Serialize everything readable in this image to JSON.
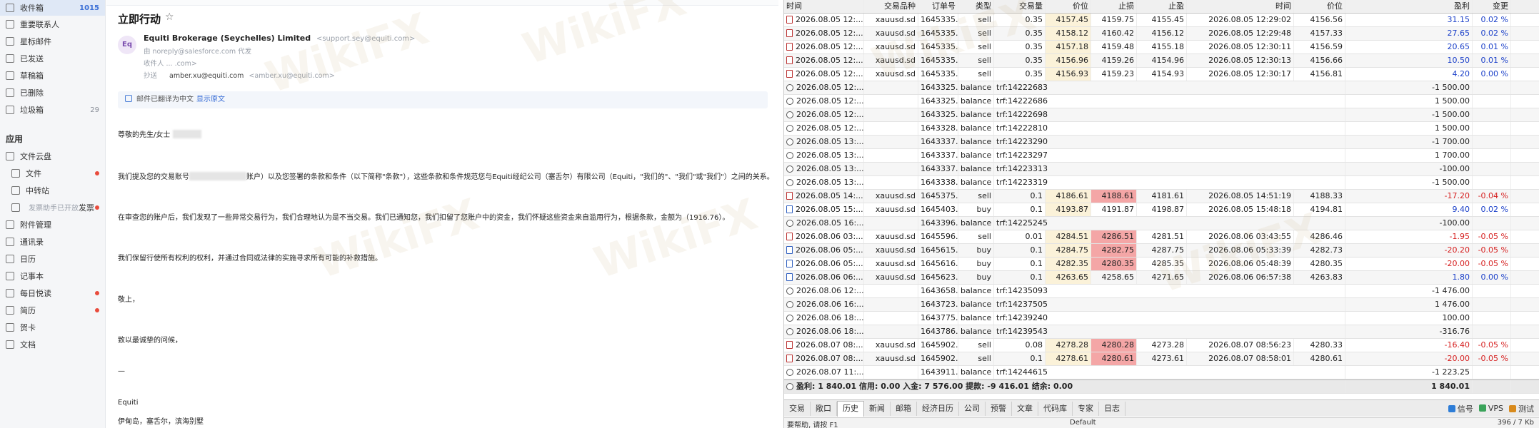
{
  "sidebar": {
    "items": [
      {
        "label": "收件箱",
        "count": "1015",
        "active": true
      },
      {
        "label": "重要联系人"
      },
      {
        "label": "星标邮件"
      },
      {
        "label": "已发送"
      },
      {
        "label": "草稿箱"
      },
      {
        "label": "已删除"
      },
      {
        "label": "垃圾箱",
        "count": "29"
      }
    ],
    "apps_title": "应用",
    "apps": [
      {
        "label": "文件云盘",
        "expand": true
      },
      {
        "label": "文件",
        "dot": true,
        "sub": true
      },
      {
        "label": "中转站",
        "sub": true
      },
      {
        "label": "发票",
        "hint": "发票助手已开放",
        "dot": true,
        "sub": true
      },
      {
        "label": "附件管理"
      },
      {
        "label": "通讯录"
      },
      {
        "label": "日历"
      },
      {
        "label": "记事本"
      },
      {
        "label": "每日悦读",
        "dot": true
      },
      {
        "label": "简历",
        "dot": true
      },
      {
        "label": "贺卡"
      },
      {
        "label": "文档"
      }
    ]
  },
  "mail": {
    "title": "立即行动",
    "avatar": "Eq",
    "sender_name": "Equiti Brokerage (Seychelles) Limited",
    "sender_email": "<support.sey@equiti.com>",
    "from_row": "由 noreply@salesforce.com 代发",
    "to_row": "收件人 ... .com>",
    "cc_label": "抄送",
    "cc_value": "amber.xu@equiti.com",
    "cc_email": "<amber.xu@equiti.com>",
    "translate_text": "邮件已翻译为中文",
    "translate_link": "显示原文",
    "greeting": "尊敬的先生/女士",
    "p1a": "我们提及您的交易账号",
    "p1b": "账户）以及您签署的条款和条件（以下简称\"条款\"），这些条款和条件规范您与Equiti经纪公司（塞舌尔）有限公司（Equiti，\"我们的\"、\"我们\"或\"我们\"）之间的关系。",
    "p2": "在审查您的账户后，我们发现了一些异常交易行为，我们合理地认为是不当交易。我们已通知您，我们扣留了您账户中的资金，我们怀疑这些资金来自滥用行为，根据条款，金额为（1916.76）。",
    "p3": "我们保留行使所有权利的权利，并通过合同或法律的实施寻求所有可能的补救措施。",
    "regards": "敬上，",
    "closing": "致以最诚挚的问候，",
    "dash": "—",
    "company": "Equiti",
    "address": "伊甸岛，塞舌尔，滨海别墅",
    "watermark": "WikiFX"
  },
  "terminal": {
    "headers": [
      "时间",
      "交易品种",
      "订单号",
      "类型",
      "交易量",
      "价位",
      "止损",
      "止盈",
      "时间",
      "价位",
      "盈利",
      "变更"
    ],
    "rows": [
      {
        "kind": "sell",
        "time": "2026.08.05 12:...",
        "sym": "xauusd.sd",
        "order": "1645335...",
        "type": "sell",
        "vol": "0.35",
        "price": "4157.45",
        "sl": "4159.75",
        "tp": "4155.45",
        "ctime": "2026.08.05 12:29:02",
        "cprice": "4156.56",
        "profit": "31.15",
        "change": "0.02 %",
        "pc": "blue",
        "chc": "blue"
      },
      {
        "kind": "sell",
        "time": "2026.08.05 12:...",
        "sym": "xauusd.sd",
        "order": "1645335...",
        "type": "sell",
        "vol": "0.35",
        "price": "4158.12",
        "sl": "4160.42",
        "tp": "4156.12",
        "ctime": "2026.08.05 12:29:48",
        "cprice": "4157.33",
        "profit": "27.65",
        "change": "0.02 %",
        "pc": "blue",
        "chc": "blue"
      },
      {
        "kind": "sell",
        "time": "2026.08.05 12:...",
        "sym": "xauusd.sd",
        "order": "1645335...",
        "type": "sell",
        "vol": "0.35",
        "price": "4157.18",
        "sl": "4159.48",
        "tp": "4155.18",
        "ctime": "2026.08.05 12:30:11",
        "cprice": "4156.59",
        "profit": "20.65",
        "change": "0.01 %",
        "pc": "blue",
        "chc": "blue"
      },
      {
        "kind": "sell",
        "time": "2026.08.05 12:...",
        "sym": "xauusd.sd",
        "order": "1645335...",
        "type": "sell",
        "vol": "0.35",
        "price": "4156.96",
        "sl": "4159.26",
        "tp": "4154.96",
        "ctime": "2026.08.05 12:30:13",
        "cprice": "4156.66",
        "profit": "10.50",
        "change": "0.01 %",
        "pc": "blue",
        "chc": "blue"
      },
      {
        "kind": "sell",
        "time": "2026.08.05 12:...",
        "sym": "xauusd.sd",
        "order": "1645335...",
        "type": "sell",
        "vol": "0.35",
        "price": "4156.93",
        "sl": "4159.23",
        "tp": "4154.93",
        "ctime": "2026.08.05 12:30:17",
        "cprice": "4156.81",
        "profit": "4.20",
        "change": "0.00 %",
        "pc": "blue",
        "chc": "blue"
      },
      {
        "kind": "bal",
        "time": "2026.08.05 12:...",
        "order": "1643325...",
        "type": "balance",
        "comment": "trf:14222683",
        "profit": "-1 500.00"
      },
      {
        "kind": "bal",
        "time": "2026.08.05 12:...",
        "order": "1643325...",
        "type": "balance",
        "comment": "trf:14222686",
        "profit": "1 500.00"
      },
      {
        "kind": "bal",
        "time": "2026.08.05 12:...",
        "order": "1643325...",
        "type": "balance",
        "comment": "trf:14222698",
        "profit": "-1 500.00"
      },
      {
        "kind": "bal",
        "time": "2026.08.05 12:...",
        "order": "1643328...",
        "type": "balance",
        "comment": "trf:14222810",
        "profit": "1 500.00"
      },
      {
        "kind": "bal",
        "time": "2026.08.05 13:...",
        "order": "1643337...",
        "type": "balance",
        "comment": "trf:14223290",
        "profit": "-1 700.00"
      },
      {
        "kind": "bal",
        "time": "2026.08.05 13:...",
        "order": "1643337...",
        "type": "balance",
        "comment": "trf:14223297",
        "profit": "1 700.00"
      },
      {
        "kind": "bal",
        "time": "2026.08.05 13:...",
        "order": "1643337...",
        "type": "balance",
        "comment": "trf:14223313",
        "profit": "-100.00"
      },
      {
        "kind": "bal",
        "time": "2026.08.05 13:...",
        "order": "1643338...",
        "type": "balance",
        "comment": "trf:14223319",
        "profit": "-1 500.00"
      },
      {
        "kind": "sell",
        "time": "2026.08.05 14:...",
        "sym": "xauusd.sd",
        "order": "1645375...",
        "type": "sell",
        "vol": "0.1",
        "price": "4186.61",
        "sl": "4188.61",
        "tp": "4181.61",
        "ctime": "2026.08.05 14:51:19",
        "cprice": "4188.33",
        "profit": "-17.20",
        "change": "-0.04 %",
        "pc": "red",
        "chc": "red",
        "slhl": true
      },
      {
        "kind": "buy",
        "time": "2026.08.05 15:...",
        "sym": "xauusd.sd",
        "order": "1645403...",
        "type": "buy",
        "vol": "0.1",
        "price": "4193.87",
        "sl": "4191.87",
        "tp": "4198.87",
        "ctime": "2026.08.05 15:48:18",
        "cprice": "4194.81",
        "profit": "9.40",
        "change": "0.02 %",
        "pc": "blue",
        "chc": "blue"
      },
      {
        "kind": "bal",
        "time": "2026.08.05 16:...",
        "order": "1643396...",
        "type": "balance",
        "comment": "trf:14225245",
        "profit": "-100.00"
      },
      {
        "kind": "sell",
        "time": "2026.08.06 03:...",
        "sym": "xauusd.sd",
        "order": "1645596...",
        "type": "sell",
        "vol": "0.01",
        "price": "4284.51",
        "sl": "4286.51",
        "tp": "4281.51",
        "ctime": "2026.08.06 03:43:55",
        "cprice": "4286.46",
        "profit": "-1.95",
        "change": "-0.05 %",
        "pc": "red",
        "chc": "red",
        "slhl": true
      },
      {
        "kind": "buy",
        "time": "2026.08.06 05:...",
        "sym": "xauusd.sd",
        "order": "1645615...",
        "type": "buy",
        "vol": "0.1",
        "price": "4284.75",
        "sl": "4282.75",
        "tp": "4287.75",
        "ctime": "2026.08.06 05:33:39",
        "cprice": "4282.73",
        "profit": "-20.20",
        "change": "-0.05 %",
        "pc": "red",
        "chc": "red",
        "slhl": true
      },
      {
        "kind": "buy",
        "time": "2026.08.06 05:...",
        "sym": "xauusd.sd",
        "order": "1645616...",
        "type": "buy",
        "vol": "0.1",
        "price": "4282.35",
        "sl": "4280.35",
        "tp": "4285.35",
        "ctime": "2026.08.06 05:48:39",
        "cprice": "4280.35",
        "profit": "-20.00",
        "change": "-0.05 %",
        "pc": "red",
        "chc": "red",
        "slhl": true
      },
      {
        "kind": "buy",
        "time": "2026.08.06 06:...",
        "sym": "xauusd.sd",
        "order": "1645623...",
        "type": "buy",
        "vol": "0.1",
        "price": "4263.65",
        "sl": "4258.65",
        "tp": "4271.65",
        "ctime": "2026.08.06 06:57:38",
        "cprice": "4263.83",
        "profit": "1.80",
        "change": "0.00 %",
        "pc": "blue",
        "chc": "blue"
      },
      {
        "kind": "bal",
        "time": "2026.08.06 12:...",
        "order": "1643658...",
        "type": "balance",
        "comment": "trf:14235093",
        "profit": "-1 476.00"
      },
      {
        "kind": "bal",
        "time": "2026.08.06 16:...",
        "order": "1643723...",
        "type": "balance",
        "comment": "trf:14237505",
        "profit": "1 476.00"
      },
      {
        "kind": "bal",
        "time": "2026.08.06 18:...",
        "order": "1643775...",
        "type": "balance",
        "comment": "trf:14239240",
        "profit": "100.00"
      },
      {
        "kind": "bal",
        "time": "2026.08.06 18:...",
        "order": "1643786...",
        "type": "balance",
        "comment": "trf:14239543",
        "profit": "-316.76"
      },
      {
        "kind": "sell",
        "time": "2026.08.07 08:...",
        "sym": "xauusd.sd",
        "order": "1645902...",
        "type": "sell",
        "vol": "0.08",
        "price": "4278.28",
        "sl": "4280.28",
        "tp": "4273.28",
        "ctime": "2026.08.07 08:56:23",
        "cprice": "4280.33",
        "profit": "-16.40",
        "change": "-0.05 %",
        "pc": "red",
        "chc": "red",
        "slhl": true
      },
      {
        "kind": "sell",
        "time": "2026.08.07 08:...",
        "sym": "xauusd.sd",
        "order": "1645902...",
        "type": "sell",
        "vol": "0.1",
        "price": "4278.61",
        "sl": "4280.61",
        "tp": "4273.61",
        "ctime": "2026.08.07 08:58:01",
        "cprice": "4280.61",
        "profit": "-20.00",
        "change": "-0.05 %",
        "pc": "red",
        "chc": "red",
        "slhl": true
      },
      {
        "kind": "bal",
        "time": "2026.08.07 11:...",
        "order": "1643911...",
        "type": "balance",
        "comment": "trf:14244615",
        "profit": "-1 223.25"
      }
    ],
    "summary": "盈利: 1 840.01  信用: 0.00  入金: 7 576.00  提款: -9 416.01  结余: 0.00",
    "summary_total": "1 840.01",
    "tabs": [
      "交易",
      "敞口",
      "历史",
      "新闻",
      "邮箱",
      "经济日历",
      "公司",
      "预警",
      "文章",
      "代码库",
      "专家",
      "日志"
    ],
    "active_tab": "历史",
    "right_items": [
      "信号",
      "VPS",
      "测试"
    ],
    "status_left": "要帮助, 请按 F1",
    "status_mid": "Default",
    "status_right": "396 / 7 Kb"
  }
}
